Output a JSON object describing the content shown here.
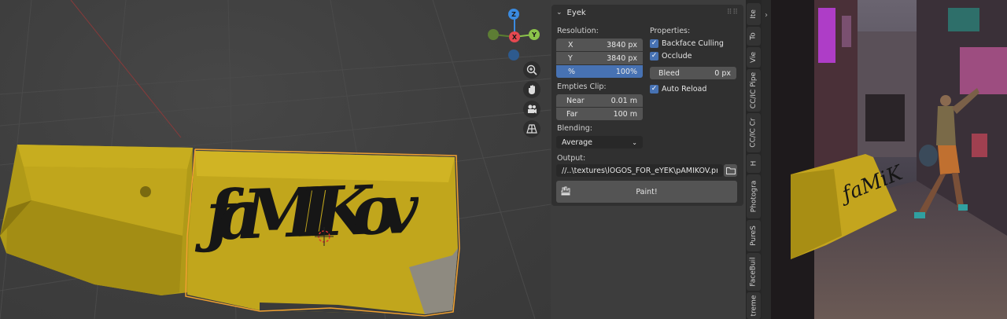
{
  "panel": {
    "title": "Eyek",
    "resolution_label": "Resolution:",
    "res_x_label": "X",
    "res_x_value": "3840 px",
    "res_y_label": "Y",
    "res_y_value": "3840 px",
    "percent_label": "%",
    "percent_value": "100%",
    "empties_clip_label": "Empties Clip:",
    "near_label": "Near",
    "near_value": "0.01 m",
    "far_label": "Far",
    "far_value": "100 m",
    "blending_label": "Blending:",
    "blending_value": "Average",
    "output_label": "Output:",
    "output_path": "//..\\textures\\lOGOS_FOR_eYEK\\pAMIKOV.png",
    "properties_label": "Properties:",
    "backface_culling_label": "Backface Culling",
    "occlude_label": "Occlude",
    "bleed_label": "Bleed",
    "bleed_value": "0 px",
    "auto_reload_label": "Auto Reload",
    "paint_label": "Paint!"
  },
  "checkboxes": {
    "backface_culling": true,
    "occlude": true,
    "auto_reload": true
  },
  "gizmo": {
    "z": "Z",
    "y": "Y",
    "x": "X"
  },
  "tabs": [
    "Ite",
    "To",
    "Vie",
    "CC/IC Pipe",
    "CC/IC Cr",
    "H",
    "Photogra",
    "PureS",
    "FaceBuil",
    "treme"
  ],
  "icons": {
    "panel_collapse": "chevron-down-icon",
    "panel_grip": "drag-grip-icon",
    "zoom": "zoom-in-icon",
    "pan": "hand-icon",
    "camera": "camera-icon",
    "ortho": "grid-icon",
    "bucket": "paint-bucket-icon",
    "folder": "folder-icon",
    "sidebar_toggle": "chevron-right-icon"
  },
  "colors": {
    "accent": "#4772b3",
    "axis_x": "#e44850",
    "axis_y": "#8bc34a",
    "axis_z": "#3b8be0",
    "selection_outline": "#f0a030"
  }
}
